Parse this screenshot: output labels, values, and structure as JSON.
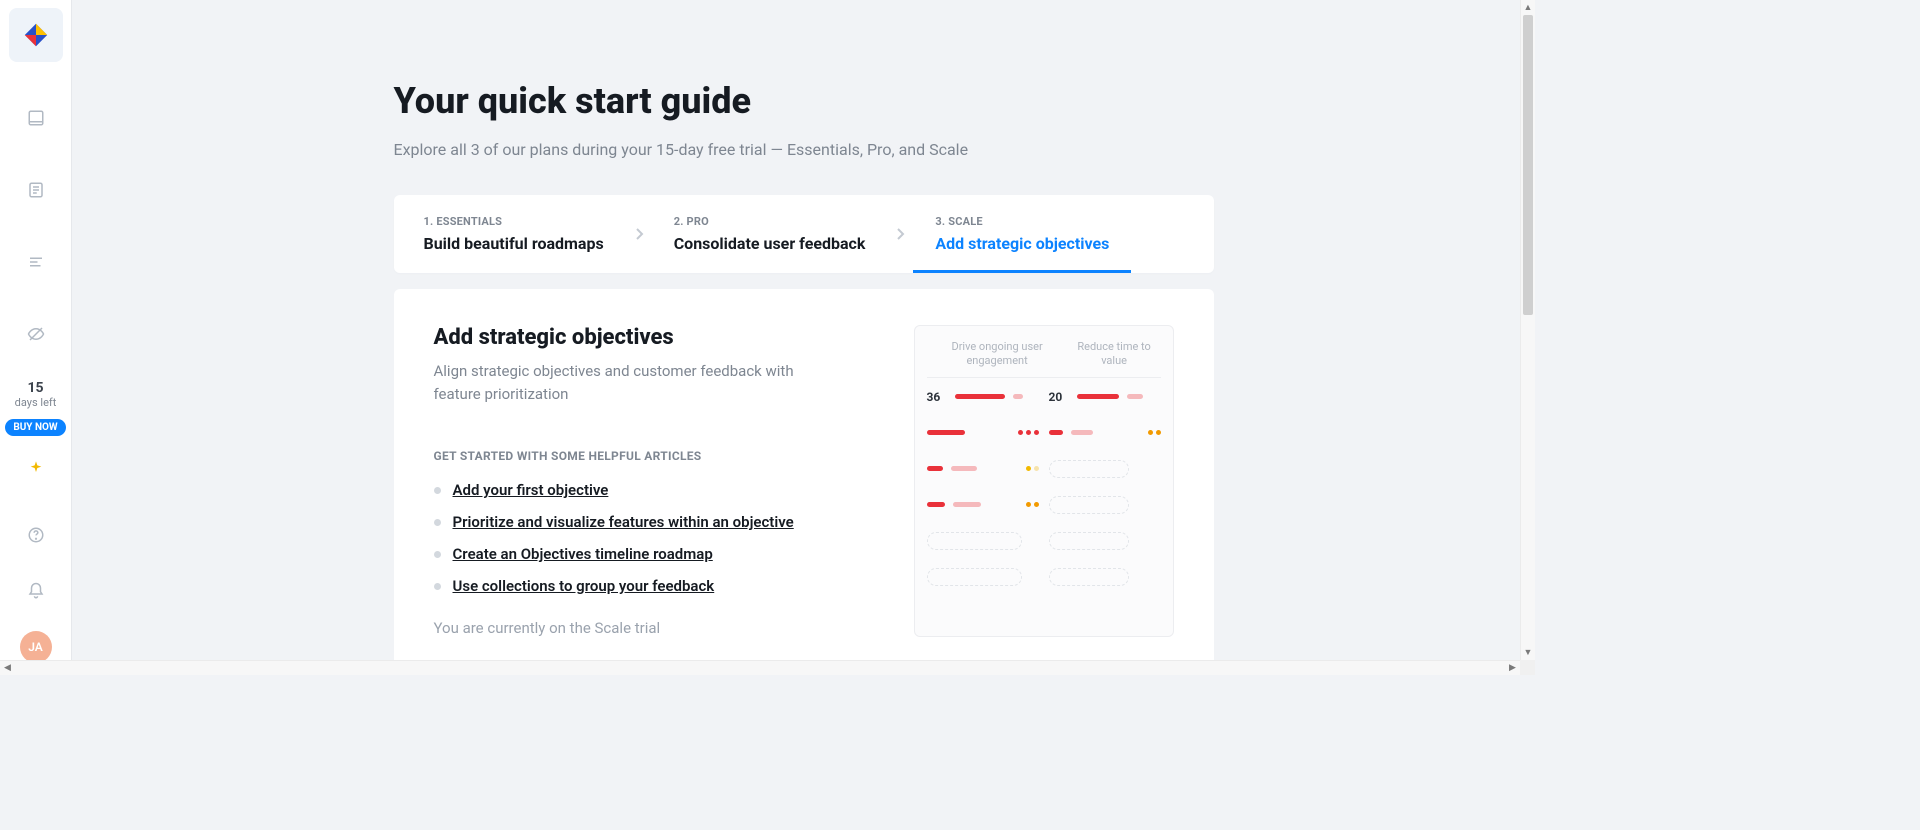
{
  "page": {
    "title": "Your quick start guide",
    "subtitle": "Explore all 3 of our plans during your 15-day free trial — Essentials, Pro, and Scale"
  },
  "sidebar": {
    "trial_count": "15",
    "trial_left": "days left",
    "buy_now": "BUY NOW",
    "avatar_initials": "JA"
  },
  "tabs": [
    {
      "kicker": "1. ESSENTIALS",
      "title": "Build beautiful roadmaps"
    },
    {
      "kicker": "2. PRO",
      "title": "Consolidate user feedback"
    },
    {
      "kicker": "3. SCALE",
      "title": "Add strategic objectives"
    }
  ],
  "panel": {
    "title": "Add strategic objectives",
    "subtitle": "Align strategic objectives and customer feedback with feature prioritization",
    "section_label": "GET STARTED WITH SOME HELPFUL ARTICLES",
    "articles": [
      "Add your first objective",
      "Prioritize and visualize features within an objective",
      "Create an Objectives timeline roadmap",
      "Use collections to group your feedback"
    ],
    "note": "You are currently on the Scale trial"
  },
  "illustration": {
    "metrics": [
      "Drive ongoing user engagement",
      "Reduce time to value"
    ],
    "values": [
      "36",
      "20"
    ]
  },
  "colors": {
    "accent": "#0c83ff",
    "red": "#e9313a"
  }
}
